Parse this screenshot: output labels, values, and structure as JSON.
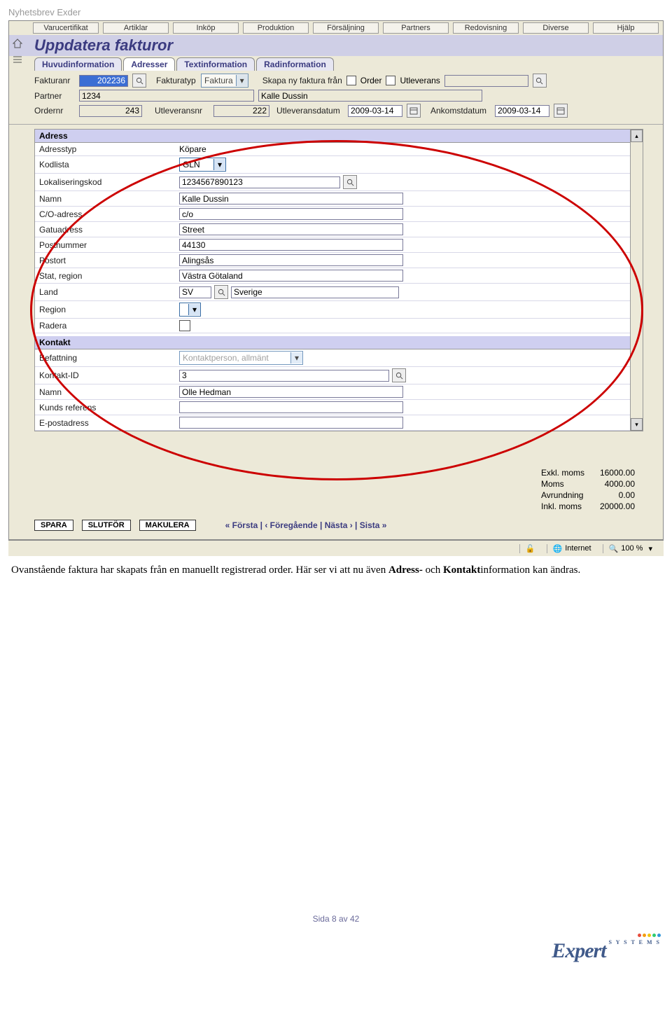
{
  "doc_header": "Nyhetsbrev Exder",
  "menu": [
    "Varucertifikat",
    "Artiklar",
    "Inköp",
    "Produktion",
    "Försäljning",
    "Partners",
    "Redovisning",
    "Diverse",
    "Hjälp"
  ],
  "page_title": "Uppdatera fakturor",
  "tabs": [
    {
      "label": "Huvudinformation",
      "active": false
    },
    {
      "label": "Adresser",
      "active": true
    },
    {
      "label": "Textinformation",
      "active": false
    },
    {
      "label": "Radinformation",
      "active": false
    }
  ],
  "header_form": {
    "fakturanr": {
      "label": "Fakturanr",
      "value": "202236"
    },
    "fakturatyp": {
      "label": "Fakturatyp",
      "value": "Faktura"
    },
    "skapa": {
      "label": "Skapa ny faktura från",
      "opts": [
        "Order",
        "Utleverans"
      ]
    },
    "partner": {
      "label": "Partner",
      "value": "1234",
      "name": "Kalle Dussin"
    },
    "ordernr": {
      "label": "Ordernr",
      "value": "243"
    },
    "utleveransnr": {
      "label": "Utleveransnr",
      "value": "222"
    },
    "utlevdatum": {
      "label": "Utleveransdatum",
      "value": "2009-03-14"
    },
    "ankomstdatum": {
      "label": "Ankomstdatum",
      "value": "2009-03-14"
    }
  },
  "adress": {
    "section": "Adress",
    "adresstyp": {
      "label": "Adresstyp",
      "value": "Köpare"
    },
    "kodlista": {
      "label": "Kodlista",
      "value": "GLN"
    },
    "lokkod": {
      "label": "Lokaliseringskod",
      "value": "1234567890123"
    },
    "namn": {
      "label": "Namn",
      "value": "Kalle Dussin"
    },
    "co": {
      "label": "C/O-adress",
      "value": "c/o"
    },
    "gatu": {
      "label": "Gatuadress",
      "value": "Street"
    },
    "postnr": {
      "label": "Postnummer",
      "value": "44130"
    },
    "postort": {
      "label": "Postort",
      "value": "Alingsås"
    },
    "stat": {
      "label": "Stat, region",
      "value": "Västra Götaland"
    },
    "land": {
      "label": "Land",
      "code": "SV",
      "name": "Sverige"
    },
    "region": {
      "label": "Region",
      "value": ""
    },
    "radera": {
      "label": "Radera"
    }
  },
  "kontakt": {
    "section": "Kontakt",
    "befattning": {
      "label": "Befattning",
      "value": "Kontaktperson, allmänt"
    },
    "kontaktid": {
      "label": "Kontakt-ID",
      "value": "3"
    },
    "namn": {
      "label": "Namn",
      "value": "Olle Hedman"
    },
    "kref": {
      "label": "Kunds referens",
      "value": ""
    },
    "epost": {
      "label": "E-postadress",
      "value": ""
    }
  },
  "totals": {
    "exkl": {
      "label": "Exkl. moms",
      "value": "16000.00"
    },
    "moms": {
      "label": "Moms",
      "value": "4000.00"
    },
    "avr": {
      "label": "Avrundning",
      "value": "0.00"
    },
    "inkl": {
      "label": "Inkl. moms",
      "value": "20000.00"
    }
  },
  "buttons": {
    "spara": "SPARA",
    "slutfor": "SLUTFÖR",
    "makulera": "MAKULERA"
  },
  "nav": "«  Första  |  ‹  Föregående  |  Nästa  ›  |  Sista  »",
  "status": {
    "zone": "Internet",
    "zoom": "100 %"
  },
  "caption": {
    "t1": "Ovanstående faktura har skapats från en manuellt registrerad order. Här ser vi att nu även ",
    "b1": "Adress-",
    "t2": " och ",
    "b2": "Kontakt",
    "t3": "information kan ändras."
  },
  "footer": "Sida 8 av 42",
  "logo": {
    "name": "Expert",
    "sys": "S Y S T E M S"
  }
}
